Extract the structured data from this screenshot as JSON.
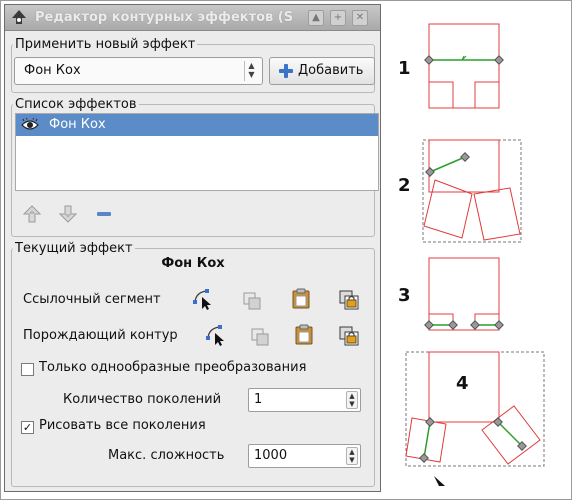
{
  "window": {
    "title": "Редактор контурных эффектов (S"
  },
  "apply_section": {
    "legend": "Применить новый эффект",
    "selected_effect": "Фон Кох",
    "add_button_label": "Добавить"
  },
  "list_section": {
    "legend": "Список эффектов",
    "items": [
      {
        "label": "Фон Кох",
        "visible": true
      }
    ]
  },
  "current_section": {
    "legend": "Текущий эффект",
    "effect_name": "Фон Кох",
    "ref_segment_label": "Ссылочный сегмент",
    "generating_path_label": "Порождающий контур",
    "uniform_only_label": "Только однообразные преобразования",
    "uniform_only_checked": false,
    "generations_label": "Количество поколений",
    "generations_value": "1",
    "draw_all_label": "Рисовать все поколения",
    "draw_all_checked": true,
    "max_complexity_label": "Макс. сложность",
    "max_complexity_value": "1000"
  },
  "figures": {
    "labels": [
      "1",
      "2",
      "3",
      "4"
    ]
  },
  "colors": {
    "selection": "#5c8cc8",
    "path_red": "#e03c3c",
    "path_green": "#2aa02a"
  }
}
